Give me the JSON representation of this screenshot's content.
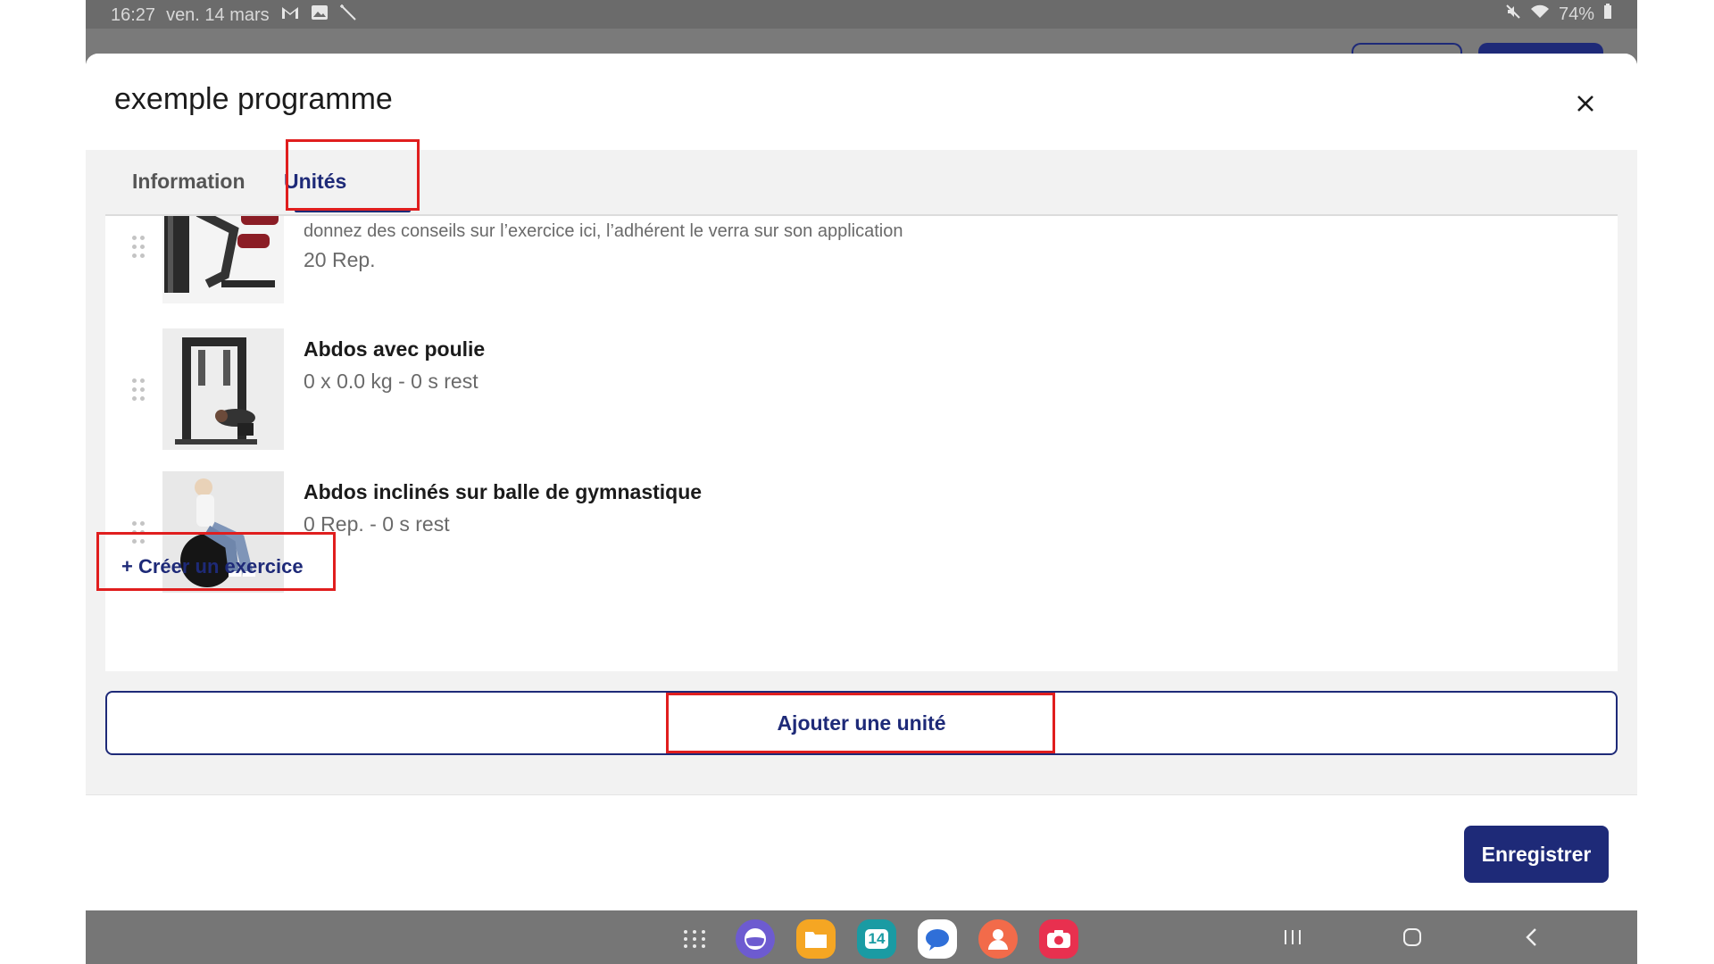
{
  "status_bar": {
    "time": "16:27",
    "date": "ven. 14 mars",
    "battery": "74%",
    "icons_left": [
      "gmail-icon",
      "gallery-icon",
      "wand-icon"
    ],
    "icons_right": [
      "mute-icon",
      "wifi-icon",
      "battery-icon"
    ]
  },
  "modal": {
    "title": "exemple programme",
    "close_icon": "close-icon",
    "tabs": [
      {
        "label": "Information",
        "active": false
      },
      {
        "label": "Unités",
        "active": true
      }
    ],
    "exercises": [
      {
        "note": "donnez des conseils sur l’exercice ici, l’adhérent le verra sur son application",
        "meta": "20 Rep."
      },
      {
        "name": "Abdos avec poulie",
        "meta": "0 x 0.0 kg - 0 s rest"
      },
      {
        "name": "Abdos inclinés sur balle de gymnastique",
        "meta": "0 Rep. - 0 s rest"
      }
    ],
    "create_exercise_label": "+ Créer un exercice",
    "add_unit_label": "Ajouter une unité",
    "save_label": "Enregistrer"
  },
  "nav_bar": {
    "calendar_day": "14",
    "apps": [
      "apps-grid-icon",
      "internet-icon",
      "files-icon",
      "calendar-icon",
      "messages-icon",
      "contacts-icon",
      "screen-recorder-icon"
    ],
    "buttons": [
      "recents-icon",
      "home-icon",
      "back-icon"
    ]
  },
  "colors": {
    "accent": "#1e2a78",
    "highlight": "#e01e1e"
  }
}
